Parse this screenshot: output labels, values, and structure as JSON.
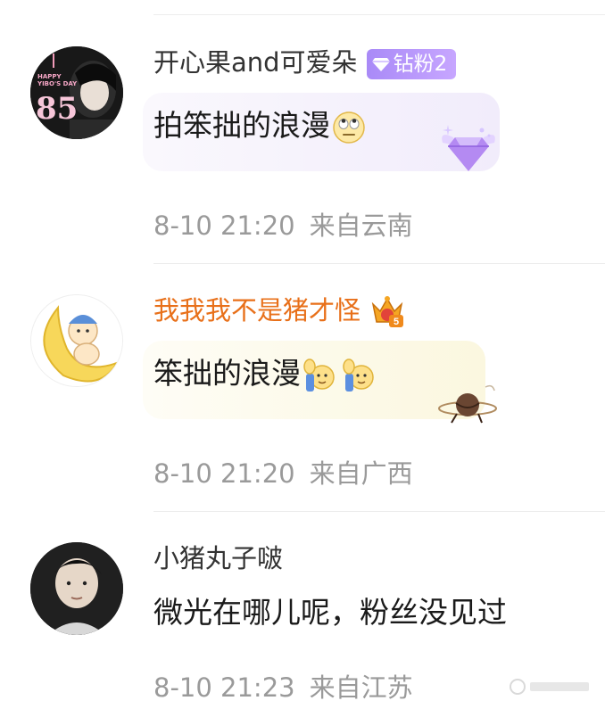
{
  "comments": [
    {
      "username": "开心果and可爱朵",
      "badge": "钻粉2",
      "text": "拍笨拙的浪漫",
      "time": "8-10 21:20",
      "location": "来自云南",
      "avatar_caption": "HAPPY YIBO'S DAY",
      "avatar_number": "85",
      "username_color": "#333333"
    },
    {
      "username": "我我我不是猪才怪",
      "text": "笨拙的浪漫",
      "time": "8-10 21:20",
      "location": "来自广西",
      "username_color": "#e8701a",
      "level_number": "5"
    },
    {
      "username": "小猪丸子啵",
      "text": "微光在哪儿呢，粉丝没见过",
      "time": "8-10 21:23",
      "location": "来自江苏",
      "username_color": "#333333"
    }
  ],
  "icons": [
    "diamond-fan-icon",
    "eye-roll-emoji",
    "raise-hand-emoji",
    "crown-level-icon",
    "planet-sticker-icon",
    "diamond-wings-icon"
  ],
  "colors": {
    "badge": "#a98af7",
    "meta": "#9a9a9a",
    "orange_name": "#e8701a"
  }
}
